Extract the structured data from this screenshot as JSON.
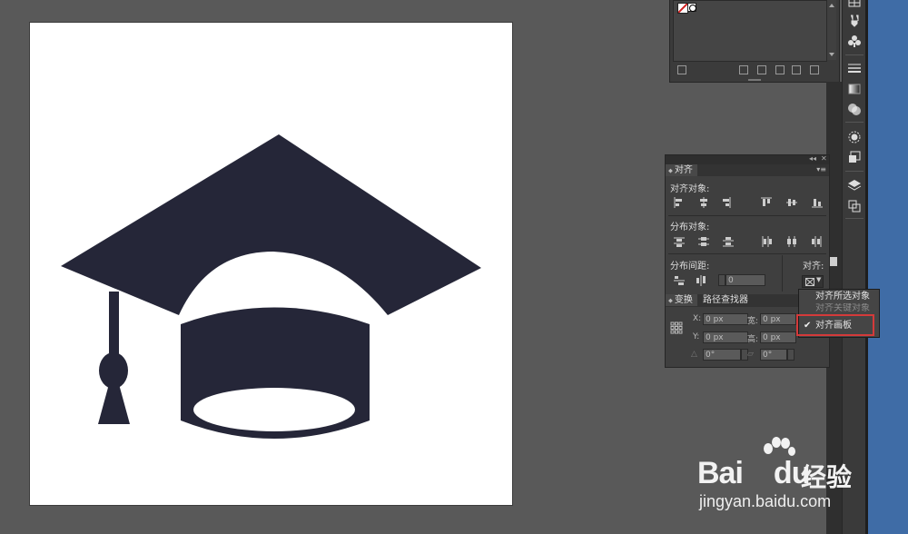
{
  "artwork": {
    "name": "graduation-cap",
    "fill": "#252638",
    "background": "#ffffff"
  },
  "align_panel": {
    "tabs": [
      {
        "label": "对齐"
      }
    ],
    "sections": {
      "align_objects": "对齐对象:",
      "distribute_objects": "分布对象:",
      "distribute_spacing": "分布间距:",
      "align_to": "对齐:"
    },
    "spacing_value": "0",
    "transform_tabs": [
      "变换",
      "路径查找器"
    ],
    "transform": {
      "x_label": "X:",
      "y_label": "Y:",
      "w_label": "宽:",
      "h_label": "高:",
      "x_value": "0 px",
      "y_value": "0 px",
      "w_value": "0 px",
      "h_value": "0 px",
      "rotate_value": "0°",
      "shear_value": "0°"
    }
  },
  "dropdown": {
    "items": [
      {
        "label": "对齐所选对象",
        "checked": false
      },
      {
        "label": "对齐关键对象",
        "checked": false,
        "disabled": true
      },
      {
        "label": "对齐画板",
        "checked": true
      }
    ],
    "highlight_color": "#d43a3a"
  },
  "dock": {
    "icons": [
      "swatches-icon",
      "brushes-icon",
      "symbols-icon",
      "stroke-icon",
      "gradient-icon",
      "transparency-icon",
      "appearance-icon",
      "graphic-styles-icon",
      "layers-icon",
      "artboards-icon"
    ]
  },
  "watermark": {
    "brand": "Bai",
    "brand_suffix": "du",
    "cn": "经验",
    "url": "jingyan.baidu.com"
  }
}
